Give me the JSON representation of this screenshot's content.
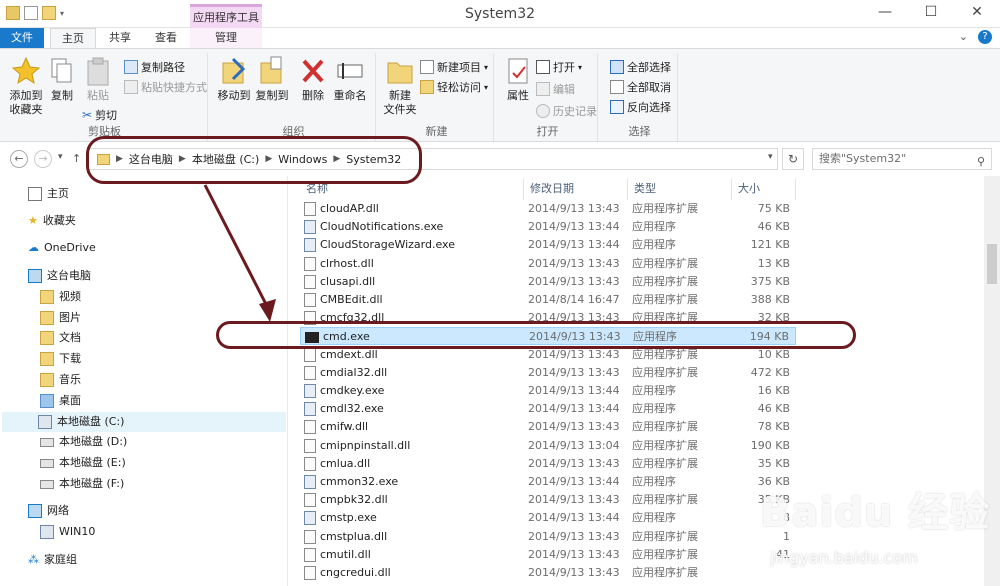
{
  "window": {
    "title": "System32",
    "context_tab_header": "应用程序工具"
  },
  "tabs": {
    "file": "文件",
    "home": "主页",
    "share": "共享",
    "view": "查看",
    "manage": "管理"
  },
  "ribbon": {
    "clipboard": {
      "pin_label": "添加到\n收藏夹",
      "copy_label": "复制",
      "paste_label": "粘贴",
      "copy_path": "复制路径",
      "paste_shortcut": "粘贴快捷方式",
      "cut": "剪切",
      "group_label": "剪贴板"
    },
    "organize": {
      "move_to": "移动到",
      "copy_to": "复制到",
      "delete": "删除",
      "rename": "重命名",
      "group_label": "组织"
    },
    "new": {
      "new_folder": "新建\n文件夹",
      "new_item": "新建项目",
      "easy_access": "轻松访问",
      "group_label": "新建"
    },
    "open": {
      "properties": "属性",
      "open": "打开",
      "edit": "编辑",
      "history": "历史记录",
      "group_label": "打开"
    },
    "select": {
      "select_all": "全部选择",
      "select_none": "全部取消",
      "invert": "反向选择",
      "group_label": "选择"
    }
  },
  "address": {
    "segments": [
      "这台电脑",
      "本地磁盘 (C:)",
      "Windows",
      "System32"
    ],
    "search_placeholder": "搜索\"System32\""
  },
  "nav": {
    "items": [
      {
        "label": "主页"
      },
      {
        "label": "收藏夹"
      },
      {
        "label": "OneDrive"
      },
      {
        "label": "这台电脑"
      },
      {
        "label": "视频"
      },
      {
        "label": "图片"
      },
      {
        "label": "文档"
      },
      {
        "label": "下载"
      },
      {
        "label": "音乐"
      },
      {
        "label": "桌面"
      },
      {
        "label": "本地磁盘 (C:)"
      },
      {
        "label": "本地磁盘 (D:)"
      },
      {
        "label": "本地磁盘 (E:)"
      },
      {
        "label": "本地磁盘 (F:)"
      },
      {
        "label": "网络"
      },
      {
        "label": "WIN10"
      },
      {
        "label": "家庭组"
      }
    ]
  },
  "columns": {
    "name": "名称",
    "date": "修改日期",
    "type": "类型",
    "size": "大小"
  },
  "files": [
    {
      "name": "cloudAP.dll",
      "date": "2014/9/13 13:43",
      "type": "应用程序扩展",
      "size": "75 KB",
      "kind": "dll"
    },
    {
      "name": "CloudNotifications.exe",
      "date": "2014/9/13 13:44",
      "type": "应用程序",
      "size": "46 KB",
      "kind": "exe"
    },
    {
      "name": "CloudStorageWizard.exe",
      "date": "2014/9/13 13:44",
      "type": "应用程序",
      "size": "121 KB",
      "kind": "exe"
    },
    {
      "name": "clrhost.dll",
      "date": "2014/9/13 13:43",
      "type": "应用程序扩展",
      "size": "13 KB",
      "kind": "dll"
    },
    {
      "name": "clusapi.dll",
      "date": "2014/9/13 13:43",
      "type": "应用程序扩展",
      "size": "375 KB",
      "kind": "dll"
    },
    {
      "name": "CMBEdit.dll",
      "date": "2014/8/14 16:47",
      "type": "应用程序扩展",
      "size": "388 KB",
      "kind": "dll"
    },
    {
      "name": "cmcfg32.dll",
      "date": "2014/9/13 13:43",
      "type": "应用程序扩展",
      "size": "32 KB",
      "kind": "dll"
    },
    {
      "name": "cmd.exe",
      "date": "2014/9/13 13:43",
      "type": "应用程序",
      "size": "194 KB",
      "kind": "cmd"
    },
    {
      "name": "cmdext.dll",
      "date": "2014/9/13 13:43",
      "type": "应用程序扩展",
      "size": "10 KB",
      "kind": "dll"
    },
    {
      "name": "cmdial32.dll",
      "date": "2014/9/13 13:43",
      "type": "应用程序扩展",
      "size": "472 KB",
      "kind": "dll"
    },
    {
      "name": "cmdkey.exe",
      "date": "2014/9/13 13:44",
      "type": "应用程序",
      "size": "16 KB",
      "kind": "exe"
    },
    {
      "name": "cmdl32.exe",
      "date": "2014/9/13 13:44",
      "type": "应用程序",
      "size": "46 KB",
      "kind": "exe"
    },
    {
      "name": "cmifw.dll",
      "date": "2014/9/13 13:43",
      "type": "应用程序扩展",
      "size": "78 KB",
      "kind": "dll"
    },
    {
      "name": "cmipnpinstall.dll",
      "date": "2014/9/13 13:04",
      "type": "应用程序扩展",
      "size": "190 KB",
      "kind": "dll"
    },
    {
      "name": "cmlua.dll",
      "date": "2014/9/13 13:43",
      "type": "应用程序扩展",
      "size": "35 KB",
      "kind": "dll"
    },
    {
      "name": "cmmon32.exe",
      "date": "2014/9/13 13:44",
      "type": "应用程序",
      "size": "36 KB",
      "kind": "exe"
    },
    {
      "name": "cmpbk32.dll",
      "date": "2014/9/13 13:43",
      "type": "应用程序扩展",
      "size": "35 KB",
      "kind": "dll"
    },
    {
      "name": "cmstp.exe",
      "date": "2014/9/13 13:44",
      "type": "应用程序",
      "size": "8",
      "kind": "exe"
    },
    {
      "name": "cmstplua.dll",
      "date": "2014/9/13 13:43",
      "type": "应用程序扩展",
      "size": "1",
      "kind": "dll"
    },
    {
      "name": "cmutil.dll",
      "date": "2014/9/13 13:43",
      "type": "应用程序扩展",
      "size": "41",
      "kind": "dll"
    },
    {
      "name": "cngcredui.dll",
      "date": "2014/9/13 13:43",
      "type": "应用程序扩展",
      "size": "",
      "kind": "dll"
    }
  ],
  "selected_file_index": 7,
  "watermark": {
    "logo": "Baidu 经验",
    "url": "jingyan.baidu.com"
  },
  "colors": {
    "accent": "#1979ca",
    "annotation": "#6b1a1f",
    "selection": "#cce8ff",
    "context_tab": "#f3d9f3"
  }
}
